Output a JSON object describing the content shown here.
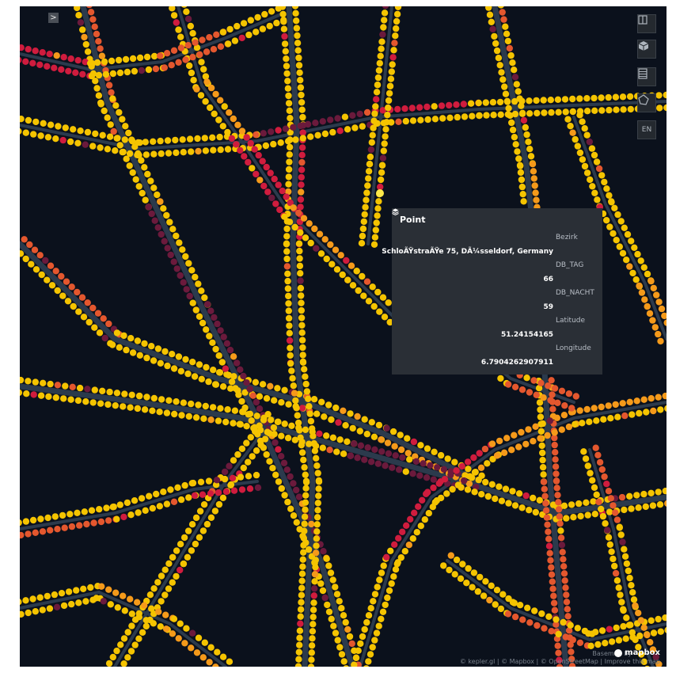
{
  "map": {
    "background": "#0b111c",
    "road_color": "#2b3a4c",
    "point_colors": [
      "#f5c400",
      "#f59a1a",
      "#e4572e",
      "#d01c3e",
      "#6b1a3c"
    ]
  },
  "controls": {
    "sidebar_toggle_icon": ">",
    "items": [
      {
        "name": "split-view-icon"
      },
      {
        "name": "3d-cube-icon"
      },
      {
        "name": "legend-icon"
      },
      {
        "name": "draw-polygon-icon"
      },
      {
        "name": "language-button",
        "label": "EN"
      }
    ]
  },
  "tooltip": {
    "title": "Point",
    "fields": [
      {
        "label": "Bezirk",
        "value": "SchloÃŸstraÃŸe 75, DÃ¼sseldorf, Germany"
      },
      {
        "label": "DB_TAG",
        "value": "66"
      },
      {
        "label": "DB_NACHT",
        "value": "59"
      },
      {
        "label": "Latitude",
        "value": "51.24154165"
      },
      {
        "label": "Longitude",
        "value": "6.7904262907911"
      }
    ]
  },
  "attribution": {
    "basemap_label": "Basemap by",
    "logo_text": "mapbox",
    "text": "© kepler.gl | © Mapbox | © OpenStreetMap | Improve this map"
  }
}
